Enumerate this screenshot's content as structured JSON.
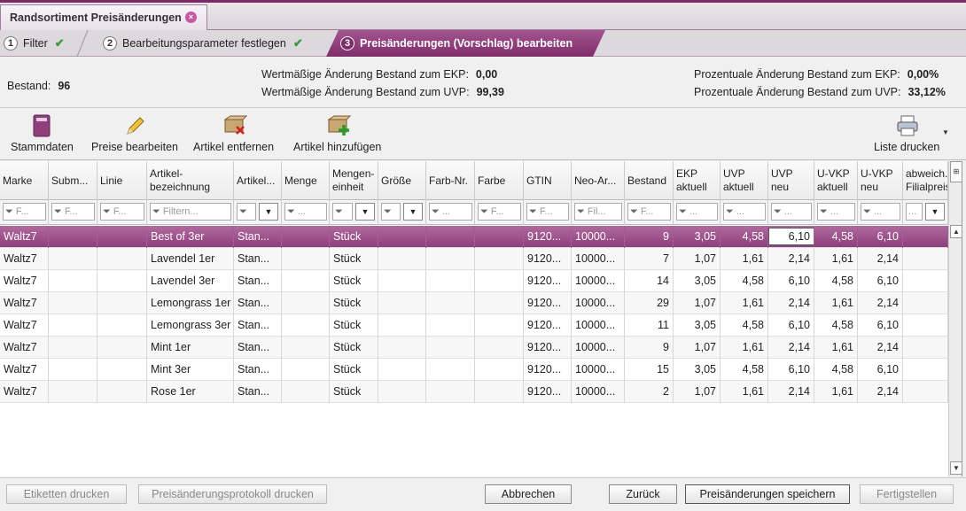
{
  "doc_tab": {
    "title": "Randsortiment Preisänderungen",
    "close": "×"
  },
  "steps": [
    {
      "num": "1",
      "label": "Filter",
      "done": "✔"
    },
    {
      "num": "2",
      "label": "Bearbeitungsparameter festlegen",
      "done": "✔"
    },
    {
      "num": "3",
      "label": "Preisänderungen (Vorschlag) bearbeiten"
    }
  ],
  "summary": {
    "bestand_label": "Bestand:",
    "bestand_value": "96",
    "wert_ekp_label": "Wertmäßige Änderung Bestand zum EKP:",
    "wert_ekp_value": "0,00",
    "wert_uvp_label": "Wertmäßige Änderung Bestand zum UVP:",
    "wert_uvp_value": "99,39",
    "proz_ekp_label": "Prozentuale Änderung Bestand zum EKP:",
    "proz_ekp_value": "0,00%",
    "proz_uvp_label": "Prozentuale Änderung Bestand zum UVP:",
    "proz_uvp_value": "33,12%"
  },
  "toolbar": {
    "stammdaten": "Stammdaten",
    "preise_bearbeiten": "Preise bearbeiten",
    "artikel_entfernen": "Artikel entfernen",
    "artikel_hinzufuegen": "Artikel hinzufügen",
    "liste_drucken": "Liste drucken"
  },
  "columns": [
    {
      "label": "Marke",
      "filter": "F..."
    },
    {
      "label": "Subm...",
      "filter": "F..."
    },
    {
      "label": "Linie",
      "filter": "F..."
    },
    {
      "label": "Artikel-\nbezeichnung",
      "filter": "Filtern..."
    },
    {
      "label": "Artikel...",
      "filter": ""
    },
    {
      "label": "Menge",
      "filter": "..."
    },
    {
      "label": "Mengen-\neinheit",
      "filter": ""
    },
    {
      "label": "Größe",
      "filter": ""
    },
    {
      "label": "Farb-Nr.",
      "filter": "..."
    },
    {
      "label": "Farbe",
      "filter": "F..."
    },
    {
      "label": "GTIN",
      "filter": "F..."
    },
    {
      "label": "Neo-Ar...",
      "filter": "Fil..."
    },
    {
      "label": "Bestand",
      "filter": "F..."
    },
    {
      "label": "EKP\naktuell",
      "filter": "..."
    },
    {
      "label": "UVP\naktuell",
      "filter": "..."
    },
    {
      "label": "UVP\nneu",
      "filter": "..."
    },
    {
      "label": "U-VKP\naktuell",
      "filter": "..."
    },
    {
      "label": "U-VKP\nneu",
      "filter": "..."
    },
    {
      "label": "abweich.\nFilialpreis",
      "filter": "..."
    }
  ],
  "rows": [
    [
      "Waltz7",
      "",
      "",
      "Best of 3er",
      "Stan...",
      "",
      "Stück",
      "",
      "",
      "",
      "9120...",
      "10000...",
      "9",
      "3,05",
      "4,58",
      "6,10",
      "4,58",
      "6,10",
      ""
    ],
    [
      "Waltz7",
      "",
      "",
      "Lavendel 1er",
      "Stan...",
      "",
      "Stück",
      "",
      "",
      "",
      "9120...",
      "10000...",
      "7",
      "1,07",
      "1,61",
      "2,14",
      "1,61",
      "2,14",
      ""
    ],
    [
      "Waltz7",
      "",
      "",
      "Lavendel 3er",
      "Stan...",
      "",
      "Stück",
      "",
      "",
      "",
      "9120...",
      "10000...",
      "14",
      "3,05",
      "4,58",
      "6,10",
      "4,58",
      "6,10",
      ""
    ],
    [
      "Waltz7",
      "",
      "",
      "Lemongrass 1er",
      "Stan...",
      "",
      "Stück",
      "",
      "",
      "",
      "9120...",
      "10000...",
      "29",
      "1,07",
      "1,61",
      "2,14",
      "1,61",
      "2,14",
      ""
    ],
    [
      "Waltz7",
      "",
      "",
      "Lemongrass 3er",
      "Stan...",
      "",
      "Stück",
      "",
      "",
      "",
      "9120...",
      "10000...",
      "11",
      "3,05",
      "4,58",
      "6,10",
      "4,58",
      "6,10",
      ""
    ],
    [
      "Waltz7",
      "",
      "",
      "Mint 1er",
      "Stan...",
      "",
      "Stück",
      "",
      "",
      "",
      "9120...",
      "10000...",
      "9",
      "1,07",
      "1,61",
      "2,14",
      "1,61",
      "2,14",
      ""
    ],
    [
      "Waltz7",
      "",
      "",
      "Mint 3er",
      "Stan...",
      "",
      "Stück",
      "",
      "",
      "",
      "9120...",
      "10000...",
      "15",
      "3,05",
      "4,58",
      "6,10",
      "4,58",
      "6,10",
      ""
    ],
    [
      "Waltz7",
      "",
      "",
      "Rose 1er",
      "Stan...",
      "",
      "Stück",
      "",
      "",
      "",
      "9120...",
      "10000...",
      "2",
      "1,07",
      "1,61",
      "2,14",
      "1,61",
      "2,14",
      ""
    ]
  ],
  "footer": {
    "etiketten": "Etiketten drucken",
    "protokoll": "Preisänderungsprotokoll drucken",
    "abbrechen": "Abbrechen",
    "zurueck": "Zurück",
    "speichern": "Preisänderungen speichern",
    "fertigstellen": "Fertigstellen"
  },
  "colors": {
    "accent": "#8e3f7c",
    "accent_light": "#b06a9e"
  }
}
